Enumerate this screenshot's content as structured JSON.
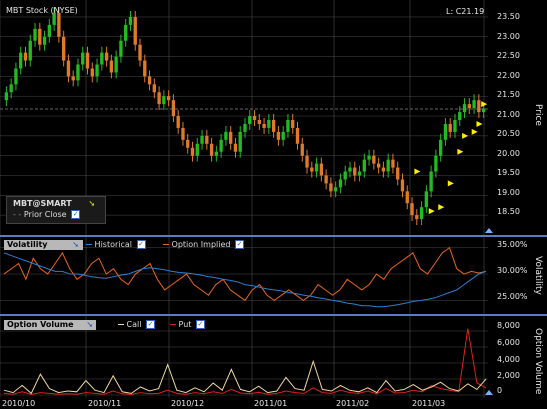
{
  "title": "MBT Stock (NYSE)",
  "last_label": "L: C21.19",
  "price_axis": {
    "title": "Price",
    "ticks": [
      "23.50",
      "23.00",
      "22.50",
      "22.00",
      "21.50",
      "21.00",
      "20.50",
      "20.00",
      "19.50",
      "19.00",
      "18.50"
    ]
  },
  "symbol_box": {
    "symbol": "MBT@SMART",
    "prior_close": "Prior Close"
  },
  "volatility": {
    "label": "Volatility",
    "historical": "Historical",
    "option_implied": "Option Implied",
    "axis_title": "Volatility",
    "ticks": [
      "35.00%",
      "30.00%",
      "25.00%"
    ]
  },
  "option_volume": {
    "label": "Option Volume",
    "call": "Call",
    "put": "Put",
    "axis_title": "Option Volume",
    "ticks": [
      "8,000",
      "6,000",
      "4,000",
      "2,000",
      "0"
    ]
  },
  "x_ticks": [
    "2010/10",
    "2010/11",
    "2010/12",
    "2011/01",
    "2011/02",
    "2011/03"
  ],
  "colors": {
    "up": "#22bb22",
    "down": "#e07a2a",
    "historical": "#2f7fd0",
    "implied": "#e8661e",
    "call": "#f0d8a0",
    "put": "#e02020",
    "grid": "#4a4a4a",
    "event_marker": "#ffee00"
  },
  "chart_data": [
    {
      "type": "candlestick",
      "title": "MBT Stock (NYSE)",
      "ylabel": "Price",
      "ylim": [
        18.2,
        23.6
      ],
      "x_ticks": [
        "2010/10",
        "2010/11",
        "2010/12",
        "2011/01",
        "2011/02",
        "2011/03"
      ],
      "close": [
        21.6,
        21.8,
        22.2,
        22.6,
        22.4,
        22.9,
        23.2,
        22.8,
        23.0,
        23.3,
        23.6,
        23.0,
        22.4,
        22.0,
        21.9,
        22.3,
        22.6,
        22.2,
        22.0,
        22.3,
        22.6,
        22.4,
        22.1,
        22.5,
        22.9,
        23.3,
        23.5,
        22.8,
        22.4,
        22.0,
        21.8,
        21.6,
        21.3,
        21.5,
        21.4,
        21.0,
        20.7,
        20.4,
        20.2,
        20.0,
        20.3,
        20.5,
        20.3,
        20.0,
        20.1,
        20.4,
        20.6,
        20.3,
        20.1,
        20.6,
        20.8,
        21.0,
        20.9,
        20.8,
        20.7,
        20.9,
        20.6,
        20.4,
        20.6,
        20.9,
        20.7,
        20.3,
        20.0,
        19.7,
        19.6,
        19.8,
        19.5,
        19.3,
        19.1,
        19.2,
        19.4,
        19.6,
        19.7,
        19.5,
        19.6,
        19.9,
        20.0,
        19.8,
        19.7,
        19.6,
        19.9,
        19.7,
        19.4,
        19.1,
        18.8,
        18.5,
        18.4,
        18.7,
        19.1,
        19.6,
        20.0,
        20.4,
        20.8,
        20.6,
        20.9,
        21.1,
        21.3,
        21.2,
        21.4,
        21.1,
        21.19
      ],
      "volatility": {
        "ylim": [
          23.0,
          35.5
        ],
        "historical": [
          34,
          33.5,
          33,
          32.5,
          32,
          31.5,
          31,
          30.5,
          30.5,
          30,
          30,
          29.8,
          29.5,
          29.3,
          29.2,
          29.5,
          29.8,
          30,
          30.5,
          31,
          31.2,
          31,
          30.8,
          30.5,
          30.3,
          30.2,
          30,
          29.8,
          29.5,
          29.3,
          29,
          28.8,
          28.5,
          28,
          27.8,
          27.5,
          27.2,
          27,
          26.8,
          26.5,
          26.3,
          26,
          25.8,
          25.5,
          25.3,
          25,
          24.8,
          24.5,
          24.3,
          24,
          24,
          23.8,
          23.8,
          24,
          24.2,
          24.5,
          24.8,
          25,
          25.2,
          25.5,
          26,
          26.5,
          27,
          28,
          29,
          30,
          30.5
        ],
        "implied": [
          30,
          31,
          32,
          29,
          33,
          31,
          30,
          32,
          34,
          31,
          29,
          30,
          32,
          33,
          30,
          31,
          29,
          28,
          30,
          31,
          32,
          29,
          27,
          28,
          29,
          30,
          28,
          27,
          26,
          28,
          29,
          27,
          26,
          25,
          27,
          28,
          26,
          25,
          26,
          27,
          26,
          25,
          26,
          28,
          27,
          26,
          27,
          29,
          28,
          27,
          28,
          30,
          29,
          31,
          32,
          33,
          34,
          31,
          30,
          32,
          34,
          35,
          31,
          30,
          30.5,
          30.2,
          30.5
        ]
      },
      "option_volume": {
        "ylim": [
          0,
          8500
        ],
        "call": [
          600,
          300,
          1200,
          200,
          2600,
          800,
          300,
          500,
          400,
          1800,
          600,
          300,
          2400,
          400,
          200,
          1000,
          500,
          800,
          3800,
          600,
          300,
          900,
          400,
          1500,
          600,
          3200,
          700,
          400,
          1100,
          300,
          500,
          2200,
          800,
          600,
          4200,
          700,
          500,
          1200,
          600,
          400,
          900,
          300,
          1800,
          500,
          700,
          1300,
          600,
          1000,
          1600,
          800,
          500,
          1400,
          700,
          2000
        ],
        "put": [
          200,
          100,
          400,
          80,
          300,
          200,
          100,
          150,
          100,
          300,
          200,
          100,
          500,
          150,
          80,
          300,
          150,
          200,
          600,
          200,
          100,
          300,
          150,
          400,
          200,
          700,
          250,
          150,
          350,
          100,
          200,
          500,
          300,
          200,
          900,
          300,
          200,
          600,
          300,
          200,
          500,
          150,
          800,
          250,
          300,
          600,
          400,
          1200,
          800,
          600,
          400,
          8300,
          1500,
          900
        ]
      }
    }
  ]
}
